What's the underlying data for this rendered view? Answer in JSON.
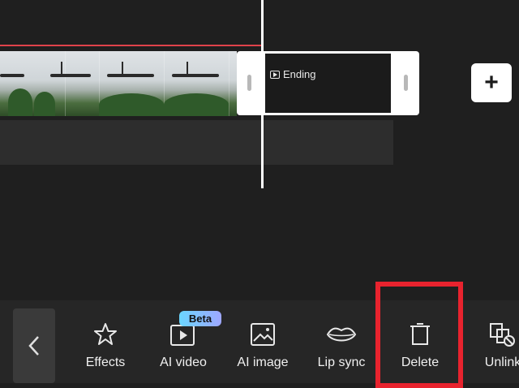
{
  "timeline": {
    "ending_clip_label": "Ending",
    "add_button_symbol": "+"
  },
  "toolbar": {
    "items": [
      {
        "label": "Effects",
        "icon": "effects-star-icon"
      },
      {
        "label": "AI video",
        "icon": "ai-video-icon",
        "badge": "Beta"
      },
      {
        "label": "AI image",
        "icon": "ai-image-icon"
      },
      {
        "label": "Lip sync",
        "icon": "lips-icon"
      },
      {
        "label": "Delete",
        "icon": "trash-icon"
      },
      {
        "label": "Unlink",
        "icon": "unlink-icon"
      }
    ]
  },
  "colors": {
    "background": "#1f1f1f",
    "toolbar": "#262626",
    "highlight": "#e8232e",
    "playhead": "#ffffff",
    "red_line": "#e0424a"
  }
}
